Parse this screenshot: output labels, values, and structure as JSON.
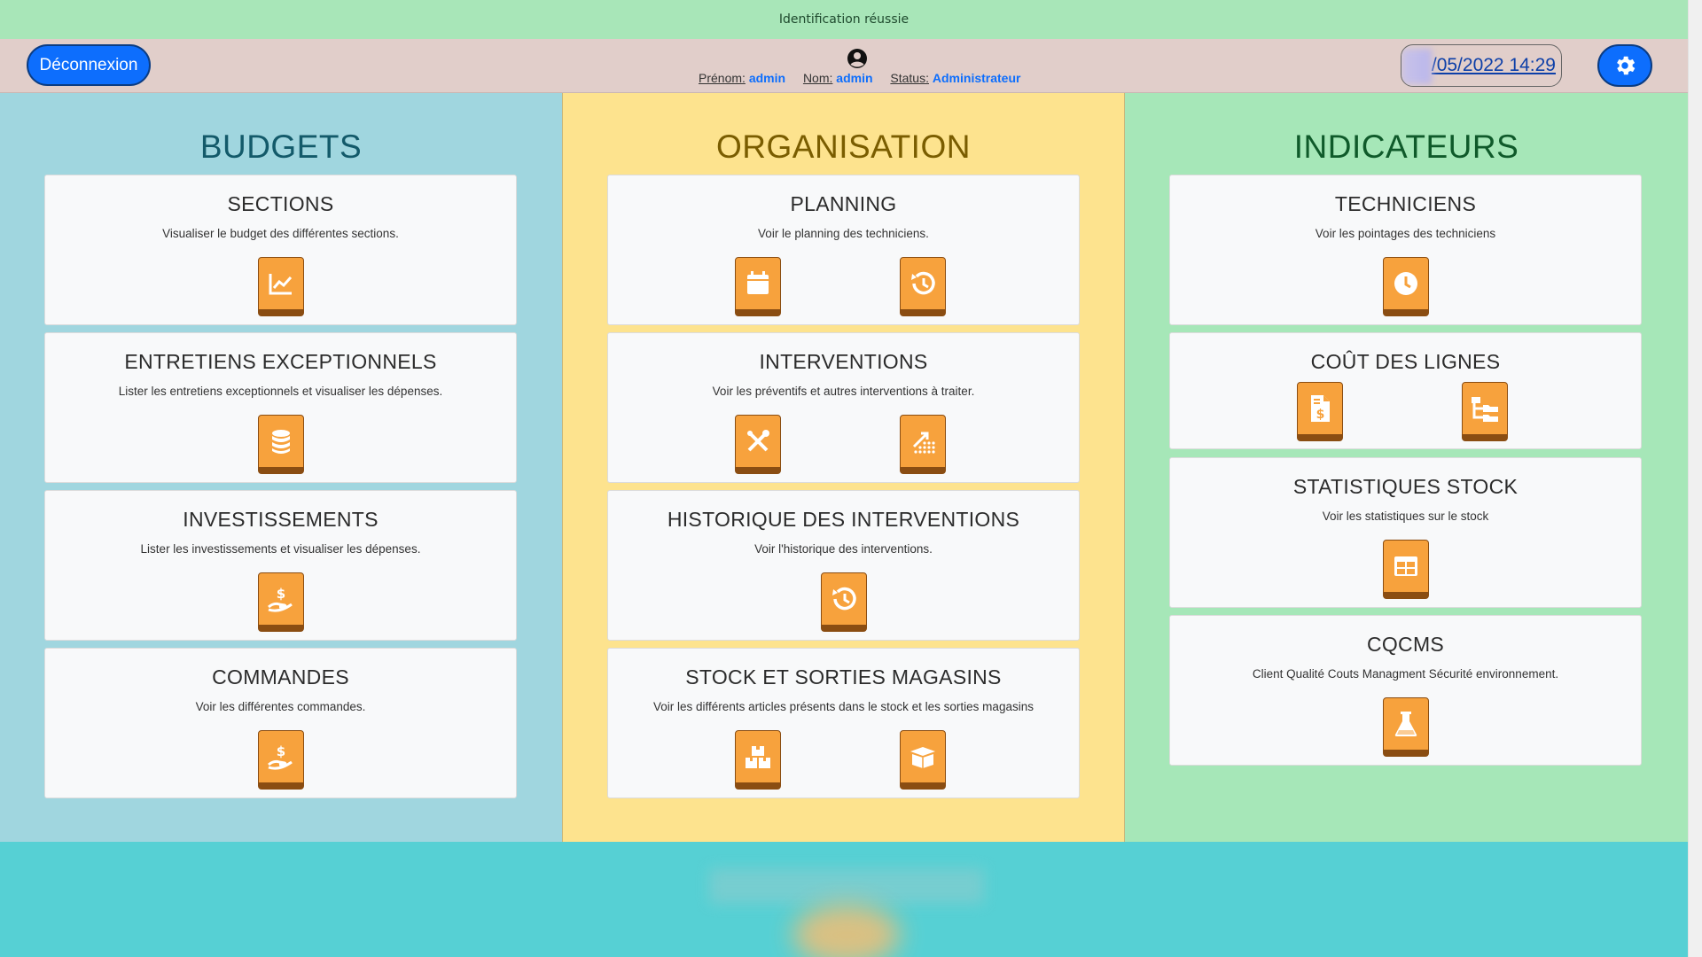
{
  "alert": {
    "message": "Identification réussie"
  },
  "topbar": {
    "logout_label": "Déconnexion",
    "user": {
      "firstname_label": "Prénom:",
      "firstname": "admin",
      "lastname_label": "Nom:",
      "lastname": "admin",
      "status_label": "Status:",
      "status": "Administrateur"
    },
    "datetime": "/05/2022 14:29"
  },
  "columns": [
    {
      "title": "BUDGETS",
      "cards": [
        {
          "title": "SECTIONS",
          "description": "Visualiser le budget des différentes sections.",
          "icons": [
            "chart-line-icon"
          ]
        },
        {
          "title": "ENTRETIENS EXCEPTIONNELS",
          "description": "Lister les entretiens exceptionnels et visualiser les dépenses.",
          "icons": [
            "coins-stack-icon"
          ]
        },
        {
          "title": "INVESTISSEMENTS",
          "description": "Lister les investissements et visualiser les dépenses.",
          "icons": [
            "hand-dollar-icon"
          ]
        },
        {
          "title": "COMMANDES",
          "description": "Voir les différentes commandes.",
          "icons": [
            "hand-dollar-icon"
          ]
        }
      ]
    },
    {
      "title": "ORGANISATION",
      "cards": [
        {
          "title": "PLANNING",
          "description": "Voir le planning des techniciens.",
          "icons": [
            "calendar-icon",
            "history-icon"
          ]
        },
        {
          "title": "INTERVENTIONS",
          "description": "Voir les préventifs et autres interventions à traiter.",
          "icons": [
            "tools-icon",
            "trend-arrow-icon"
          ]
        },
        {
          "title": "HISTORIQUE DES INTERVENTIONS",
          "description": "Voir l'historique des interventions.",
          "icons": [
            "history-icon"
          ]
        },
        {
          "title": "STOCK ET SORTIES MAGASINS",
          "description": "Voir les différents articles présents dans le stock et les sorties magasins",
          "icons": [
            "boxes-icon",
            "open-box-icon"
          ]
        }
      ]
    },
    {
      "title": "INDICATEURS",
      "cards": [
        {
          "title": "TECHNICIENS",
          "description": "Voir les pointages des techniciens",
          "icons": [
            "clock-icon"
          ]
        },
        {
          "title": "COÛT DES LIGNES",
          "description": "",
          "icons": [
            "invoice-dollar-icon",
            "folder-tree-icon"
          ]
        },
        {
          "title": "STATISTIQUES STOCK",
          "description": "Voir les statistiques sur le stock",
          "icons": [
            "table-icon"
          ]
        },
        {
          "title": "CQCMS",
          "description": "Client Qualité Couts Managment Sécurité environnement.",
          "icons": [
            "flask-icon"
          ]
        }
      ]
    }
  ],
  "colors": {
    "alert_bg": "#a8e6b8",
    "topbar_bg": "#e1ceca",
    "budgets_bg": "#a0d6df",
    "organisation_bg": "#fde38e",
    "indicateurs_bg": "#a6e7b8",
    "icon_button": "#f7a23d",
    "primary": "#0d6efd"
  }
}
